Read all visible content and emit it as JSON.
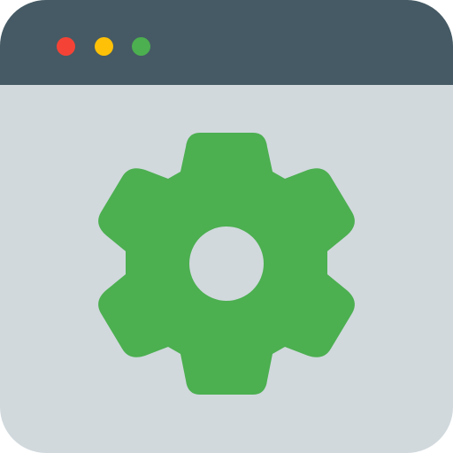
{
  "window": {
    "titlebar_color": "#455a64",
    "body_color": "#d1d9dd",
    "controls": [
      {
        "name": "close",
        "color": "#f44336"
      },
      {
        "name": "minimize",
        "color": "#ffc107"
      },
      {
        "name": "maximize",
        "color": "#4caf50"
      }
    ]
  },
  "content": {
    "icon": "gear-icon",
    "icon_color": "#4caf50"
  }
}
